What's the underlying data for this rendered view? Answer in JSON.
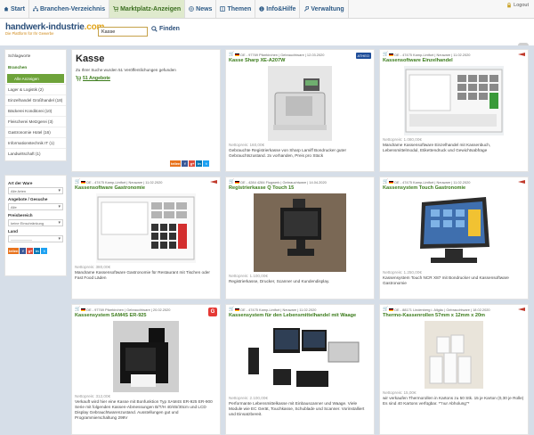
{
  "nav": {
    "start": "Start",
    "branchen": "Branchen-Verzeichnis",
    "marktplatz": "Marktplatz-Anzeigen",
    "news": "News",
    "themen": "Themen",
    "info": "Info&Hilfe",
    "verwaltung": "Verwaltung",
    "logout": "Logout"
  },
  "logo": {
    "main": "handwerk-industrie",
    "tld": ".com",
    "sub": "Die Plattform für Ihr Gewerbe"
  },
  "search": {
    "value": "Kasse",
    "button": "Finden"
  },
  "sidebar": {
    "schlagworte": "Schlagworte",
    "branchen": "Branchen",
    "alle": "Alle Anzeigen",
    "cats": [
      "Lager & Logistik (2)",
      "Einzelhandel Großhandel (18)",
      "Bäckerei Konditorei (10)",
      "Fleischerei Metzgerei (3)",
      "Gastronomie Hotel (16)",
      "Informationstechnik IT (1)",
      "Landwirtschaft (1)"
    ]
  },
  "filters": {
    "art_label": "Art der Ware",
    "art_value": "Alle Arten",
    "angebote_label": "Angebote / Gesuche",
    "angebote_value": "Alle",
    "preis_label": "Preisbereich",
    "preis_value": "keine Einschränkung",
    "land_label": "Land",
    "land_value": "——————"
  },
  "share": {
    "teilen": "teilen",
    "fb": "f",
    "gplus": "g+",
    "in": "in",
    "tw": "t"
  },
  "results": {
    "title": "Kasse",
    "info": "Zu Ihrer Suche wurden 51 Veröffentlichungen gefunden",
    "count": "51 Angebote"
  },
  "cards": [
    {
      "meta": "DE - 97769 Pfarrkirchen | Gebrauchtware | 12.03.2020",
      "title": "Kasse Sharp XE-A207W",
      "price": "Nettopreis: 160,00€",
      "desc": "Gebrauchte Registrierkasse von Sharp Lamiff Bondrucker guter Gebrauchtszustand. 2x vorhanden, Preis pro Stück",
      "badge": "ATHEO"
    },
    {
      "meta": "DE - 47475 Kamp-Lintfort | Neuware | 11.02.2020",
      "title": "Kassensoftware Einzelhandel",
      "price": "Nettopreis: 1.080,00€",
      "desc": "Mandrame Kassensoftware Einzelhandel mit Kassenbuch, Lebensmittelmodul, Etikettendruck und Gewichtsabfrage"
    },
    {
      "meta": "DE - 47475 Kamp-Lintfort | Neuware | 11.02.2020",
      "title": "Kassensoftware Gastronomie",
      "price": "Nettopreis: 380,00€",
      "desc": "Mandrame Kassensoftware Gastronomie für Restaurant mit Tischen oder Fast Food Läden"
    },
    {
      "meta": "DE - 4284 4284 Flugwerk | Gebrauchtware | 14.04.2020",
      "title": "Registrierkasse Q Touch 15",
      "price": "Nettopreis: 1.100,00€",
      "desc": "Registrierkasse, Drucker, Scanner und Kundendisplay."
    },
    {
      "meta": "DE - 47475 Kamp-Lintfort | Neuware | 11.02.2020",
      "title": "Kassensystem Touch Gastronomie",
      "price": "Nettopreis: 1.250,00€",
      "desc": "Kassensystem Touch NCR X87 mit Bondrucker und Kassensoftware Gastronomie"
    },
    {
      "meta": "DE - 97769 Pfarrkirchen | Gebrauchtware | 20.02.2020",
      "title": "Kassensystem SAM4S ER-925",
      "price": "Nettopreis: 312,00€",
      "desc": "Verkauft wird hier eine Kasse mit Bonfunktion Typ SAM4S ER-925 ER-900 Serie mit folgenden Kassen-Abmessungen B/T/H 40/45/30cm und LCD Display Gebrauchtwarenzustand. Ausstellungen gut und Programmierschaltung 299V",
      "badge": "G"
    },
    {
      "meta": "DE - 47475 Kamp-Lintfort | Neuware | 11.02.2020",
      "title": "Kassensystem für den Lebensmittelhandel mit Waage",
      "price": "Nettopreis: 2.100,00€",
      "desc": "Performante Lebensmittelkasse mit Einbauscanner und Waage. Viele Module wie EC Gerät, Touchkasse, Schublade und Scanner. Vorinstalliert und Einsatzbereit."
    },
    {
      "meta": "DE - 88171 Lindenberg i. Allgäu | Gebrauchtware | 18.02.2020",
      "title": "Thermo-Kassenrollen 57mm x 12mm x 20m",
      "price": "Nettopreis: 15,00€",
      "desc": "wir verkaufen Thermorollen in Kartons zu 50 Stk. 15 je Karton (0,30 je Rolle) Es sind 40 Kartons verfügbar. *\"nur Abholung\"*"
    }
  ]
}
